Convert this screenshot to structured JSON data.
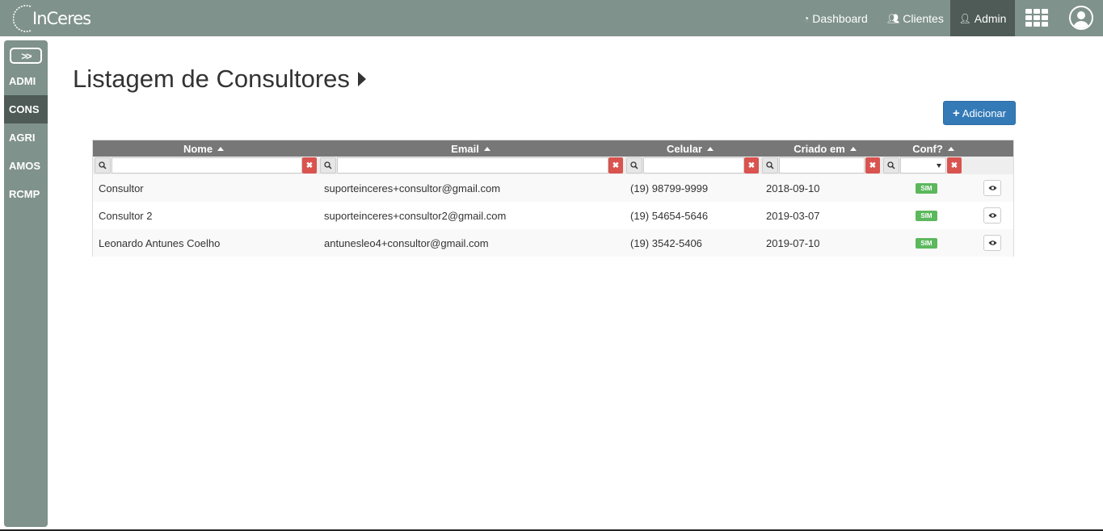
{
  "brand": {
    "logo_text": "InCeres"
  },
  "topnav": {
    "dashboard_label": "Dashboard",
    "clientes_label": "Clientes",
    "admin_label": "Admin"
  },
  "sidebar": {
    "toggle_icon": "double-chevron-right-icon",
    "items": [
      {
        "label": "ADMI",
        "active": false
      },
      {
        "label": "CONS",
        "active": true
      },
      {
        "label": "AGRI",
        "active": false
      },
      {
        "label": "AMOS",
        "active": false
      },
      {
        "label": "RCMP",
        "active": false
      }
    ]
  },
  "page": {
    "title": "Listagem de Consultores",
    "add_button_label": "Adicionar"
  },
  "table": {
    "columns": [
      "Nome",
      "Email",
      "Celular",
      "Criado em",
      "Conf?"
    ],
    "filters": {
      "nome": "",
      "email": "",
      "celular": "",
      "criado_em": "",
      "conf": ""
    },
    "rows": [
      {
        "nome": "Consultor",
        "email": "suporteinceres+consultor@gmail.com",
        "celular": "(19) 98799-9999",
        "criado_em": "2018-09-10",
        "conf": "SIM"
      },
      {
        "nome": "Consultor 2",
        "email": "suporteinceres+consultor2@gmail.com",
        "celular": "(19) 54654-5646",
        "criado_em": "2019-03-07",
        "conf": "SIM"
      },
      {
        "nome": "Leonardo Antunes Coelho",
        "email": "antunesleo4+consultor@gmail.com",
        "celular": "(19) 3542-5406",
        "criado_em": "2019-07-10",
        "conf": "SIM"
      }
    ]
  },
  "colors": {
    "navbar": "#7f928b",
    "active_dark": "#4e5b56",
    "primary": "#337ab7",
    "danger": "#d9534f",
    "success": "#5cb85c"
  }
}
